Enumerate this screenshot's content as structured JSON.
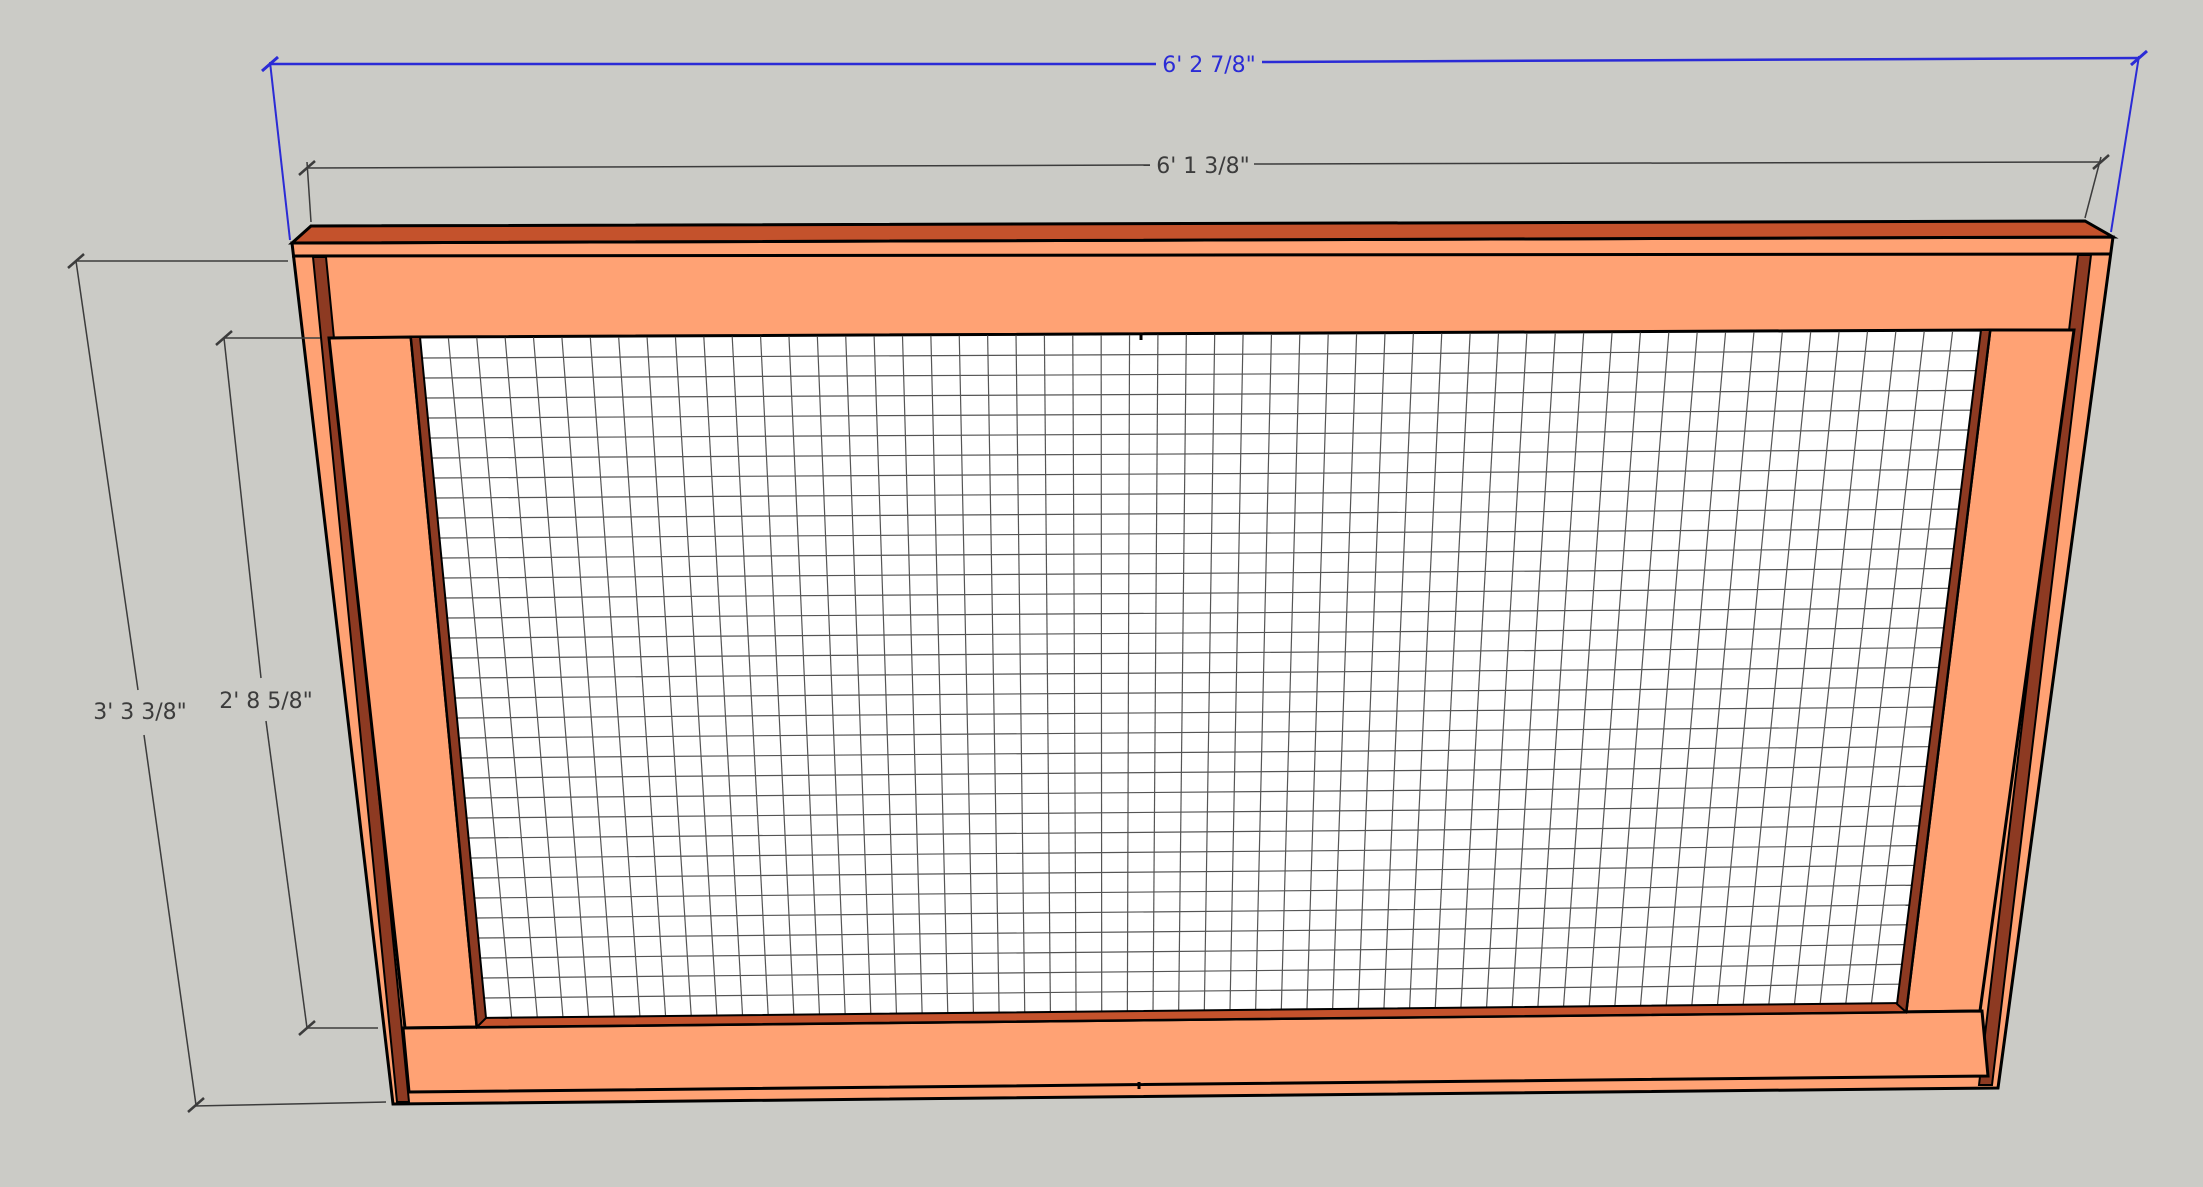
{
  "drawing": {
    "background_color": "#cbcbc6",
    "wood_face_color": "#ffa274",
    "wood_edge_color": "#c4522c",
    "wood_dark_color": "#8d3a22",
    "mesh_color": "#ffffff",
    "outline_color": "#000000",
    "dimension_color": "#3c3c3c",
    "selected_dimension_color": "#2b2bd6"
  },
  "dimensions": {
    "overall_width": "6' 2 7/8\"",
    "inner_width": "6' 1 3/8\"",
    "overall_height": "3' 3 3/8\"",
    "inner_height": "2' 8 5/8\""
  },
  "mesh": {
    "columns": 55,
    "rows": 34
  }
}
